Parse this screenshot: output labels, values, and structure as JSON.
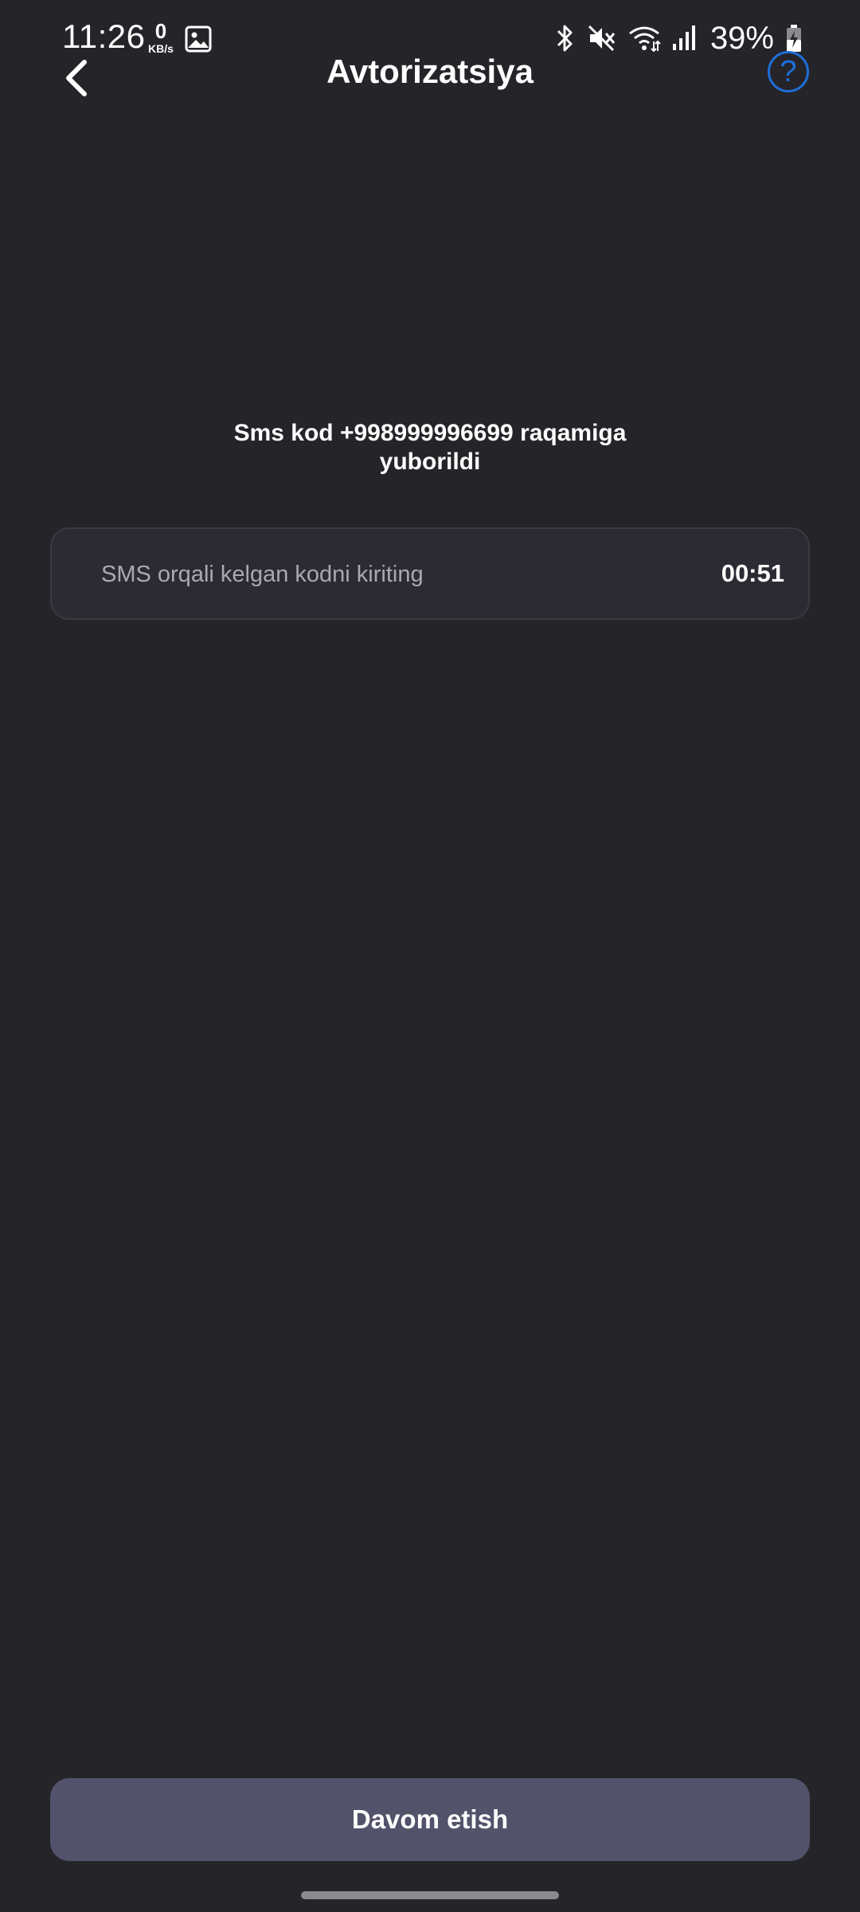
{
  "status_bar": {
    "time": "11:26",
    "net_speed_value": "0",
    "net_speed_unit": "KB/s",
    "battery_percent": "39%",
    "icons": [
      "gallery-icon",
      "bluetooth-icon",
      "mute-icon",
      "wifi-icon",
      "signal-icon",
      "battery-charging-icon"
    ]
  },
  "header": {
    "title": "Avtorizatsiya",
    "back_icon": "chevron-left-icon",
    "help_label": "?"
  },
  "main": {
    "message_line1": "Sms kod +998999996699 raqamiga",
    "message_line2": "yuborildi",
    "code_input": {
      "value": "",
      "placeholder": "SMS orqali kelgan kodni kiriting"
    },
    "timer": "00:51"
  },
  "footer": {
    "continue_label": "Davom etish"
  },
  "colors": {
    "background": "#252429",
    "accent": "#1e6fd9",
    "input_background": "#2c2b33",
    "button_background": "#52526b"
  }
}
